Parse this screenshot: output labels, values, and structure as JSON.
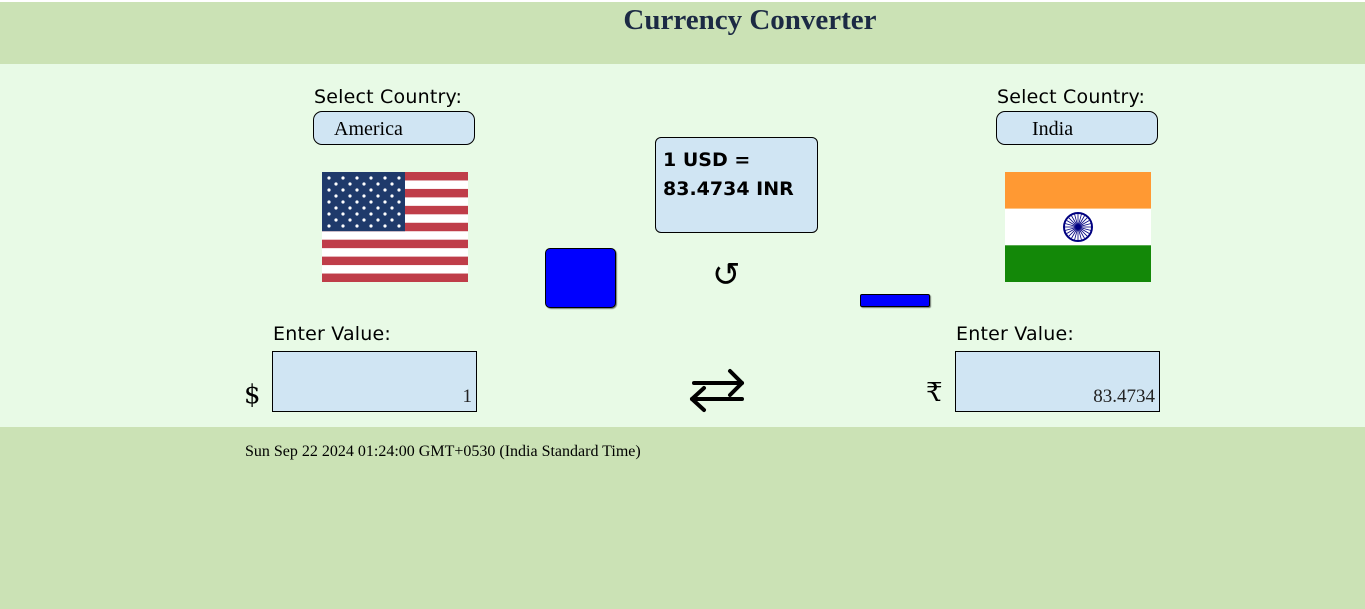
{
  "header": {
    "title": "Currency Converter"
  },
  "from": {
    "select_label": "Select Country:",
    "country": "America",
    "value_label": "Enter Value:",
    "symbol": "$",
    "value": "1"
  },
  "to": {
    "select_label": "Select Country:",
    "country": "India",
    "value_label": "Enter Value:",
    "symbol": "₹",
    "value": "83.4734"
  },
  "rate": {
    "line1": "1 USD =",
    "line2": "83.4734 INR"
  },
  "icons": {
    "refresh": "↺"
  },
  "datetime": "Sun Sep 22 2024 01:24:00 GMT+0530 (India Standard Time)",
  "colors": {
    "background": "#cbe2b5",
    "panel": "#e8fae6",
    "input_bg": "#d0e5f3",
    "button_blue": "#0000ff",
    "title": "#1c2a44"
  }
}
